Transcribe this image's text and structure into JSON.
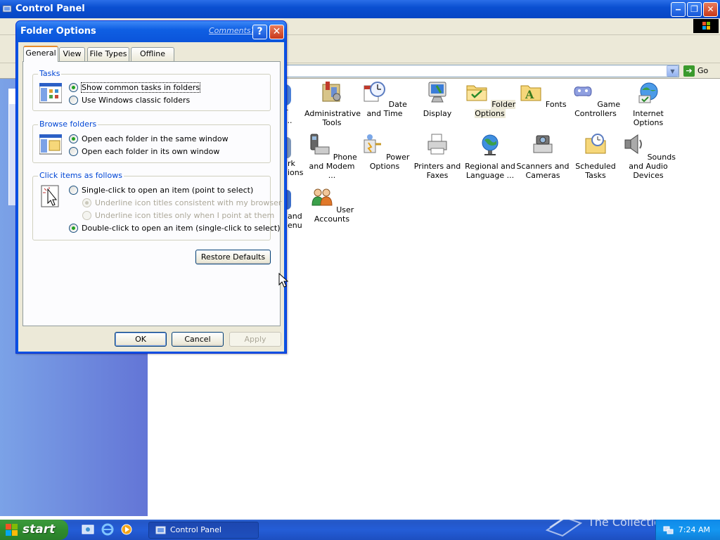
{
  "control_panel": {
    "title": "Control Panel",
    "address_go": "Go",
    "items": [
      {
        "label": "Administrative Tools",
        "icon": "administrative-tools-icon"
      },
      {
        "label": "Date and Time",
        "icon": "date-time-icon"
      },
      {
        "label": "Display",
        "icon": "display-icon"
      },
      {
        "label": "Folder Options",
        "icon": "folder-options-icon"
      },
      {
        "label": "Fonts",
        "icon": "fonts-icon"
      },
      {
        "label": "Game Controllers",
        "icon": "game-controllers-icon"
      },
      {
        "label": "Internet Options",
        "icon": "internet-options-icon"
      },
      {
        "label": "Phone and Modem ...",
        "icon": "phone-modem-icon"
      },
      {
        "label": "Power Options",
        "icon": "power-options-icon"
      },
      {
        "label": "Printers and Faxes",
        "icon": "printers-faxes-icon"
      },
      {
        "label": "Regional and Language ...",
        "icon": "regional-language-icon"
      },
      {
        "label": "Scanners and Cameras",
        "icon": "scanners-cameras-icon"
      },
      {
        "label": "Scheduled Tasks",
        "icon": "scheduled-tasks-icon"
      },
      {
        "label": "Sounds and Audio Devices",
        "icon": "sounds-audio-icon"
      },
      {
        "label": "User Accounts",
        "icon": "user-accounts-icon"
      }
    ],
    "clipped_labels": [
      "r",
      "...",
      "rk",
      "ions",
      "and",
      "enu"
    ]
  },
  "dialog": {
    "title": "Folder Options",
    "comments_link": "Comments?",
    "help": "?",
    "close": "✕",
    "tabs": [
      "General",
      "View",
      "File Types",
      "Offline Files"
    ],
    "active_tab": "General",
    "tasks": {
      "label": "Tasks",
      "option1": "Show common tasks in folders",
      "option2": "Use Windows classic folders",
      "selected": 1
    },
    "browse": {
      "label": "Browse folders",
      "option1": "Open each folder in the same window",
      "option2": "Open each folder in its own window",
      "selected": 1
    },
    "click": {
      "label": "Click items as follows",
      "option1": "Single-click to open an item (point to select)",
      "sub1": "Underline icon titles consistent with my browser",
      "sub2": "Underline icon titles only when I point at them",
      "option2": "Double-click to open an item (single-click to select)",
      "selected": 2
    },
    "restore_defaults": "Restore Defaults",
    "ok": "OK",
    "cancel": "Cancel",
    "apply": "Apply"
  },
  "taskbar": {
    "start": "start",
    "task_label": "Control Panel",
    "clock": "7:24 AM"
  },
  "watermark": "The Collection Book",
  "colors": {
    "xp_blue": "#0a54e3",
    "dialog_face": "#ece9d8",
    "group_label": "#0046d5",
    "start_green": "#2f8c2f"
  }
}
